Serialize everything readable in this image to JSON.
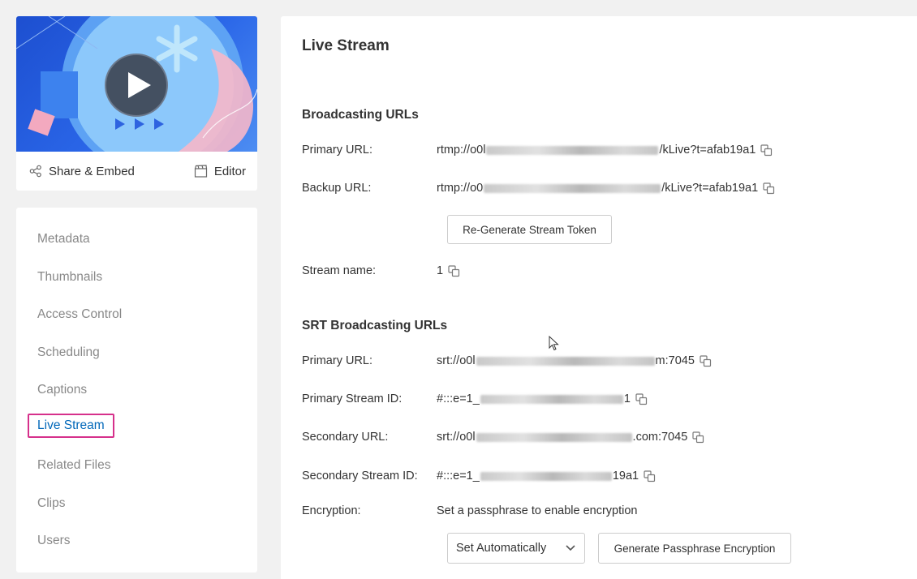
{
  "thumbnail": {
    "share_label": "Share & Embed",
    "editor_label": "Editor"
  },
  "sidebar": {
    "items": [
      {
        "label": "Metadata"
      },
      {
        "label": "Thumbnails"
      },
      {
        "label": "Access Control"
      },
      {
        "label": "Scheduling"
      },
      {
        "label": "Captions"
      },
      {
        "label": "Live Stream",
        "active": true
      },
      {
        "label": "Related Files"
      },
      {
        "label": "Clips"
      },
      {
        "label": "Users"
      }
    ]
  },
  "main": {
    "title": "Live Stream",
    "broadcasting": {
      "heading": "Broadcasting URLs",
      "primary_label": "Primary URL:",
      "primary_prefix": "rtmp://o0l",
      "primary_suffix": "/kLive?t=afab19a1",
      "backup_label": "Backup URL:",
      "backup_prefix": "rtmp://o0",
      "backup_suffix": "/kLive?t=afab19a1",
      "regenerate_button": "Re-Generate Stream Token",
      "stream_name_label": "Stream name:",
      "stream_name_value": "1"
    },
    "srt": {
      "heading": "SRT Broadcasting URLs",
      "primary_url_label": "Primary URL:",
      "primary_url_prefix": "srt://o0l",
      "primary_url_suffix": "m:7045",
      "primary_stream_id_label": "Primary Stream ID:",
      "primary_stream_id_prefix": "#:::e=1_",
      "primary_stream_id_suffix": "1",
      "secondary_url_label": "Secondary URL:",
      "secondary_url_prefix": "srt://o0l",
      "secondary_url_suffix": ".com:7045",
      "secondary_stream_id_label": "Secondary Stream ID:",
      "secondary_stream_id_prefix": "#:::e=1_",
      "secondary_stream_id_suffix": "19a1",
      "encryption_label": "Encryption:",
      "encryption_text": "Set a passphrase to enable encryption",
      "encryption_select_value": "Set Automatically",
      "generate_button": "Generate Passphrase Encryption"
    }
  },
  "colors": {
    "active_nav": "#0067b9",
    "active_outline": "#d6308b",
    "thumbnail_blue": "#2a66e8"
  },
  "icons": [
    "play-icon",
    "share-icon",
    "editor-icon",
    "copy-icon",
    "chevron-down-icon",
    "mouse-pointer-icon"
  ]
}
